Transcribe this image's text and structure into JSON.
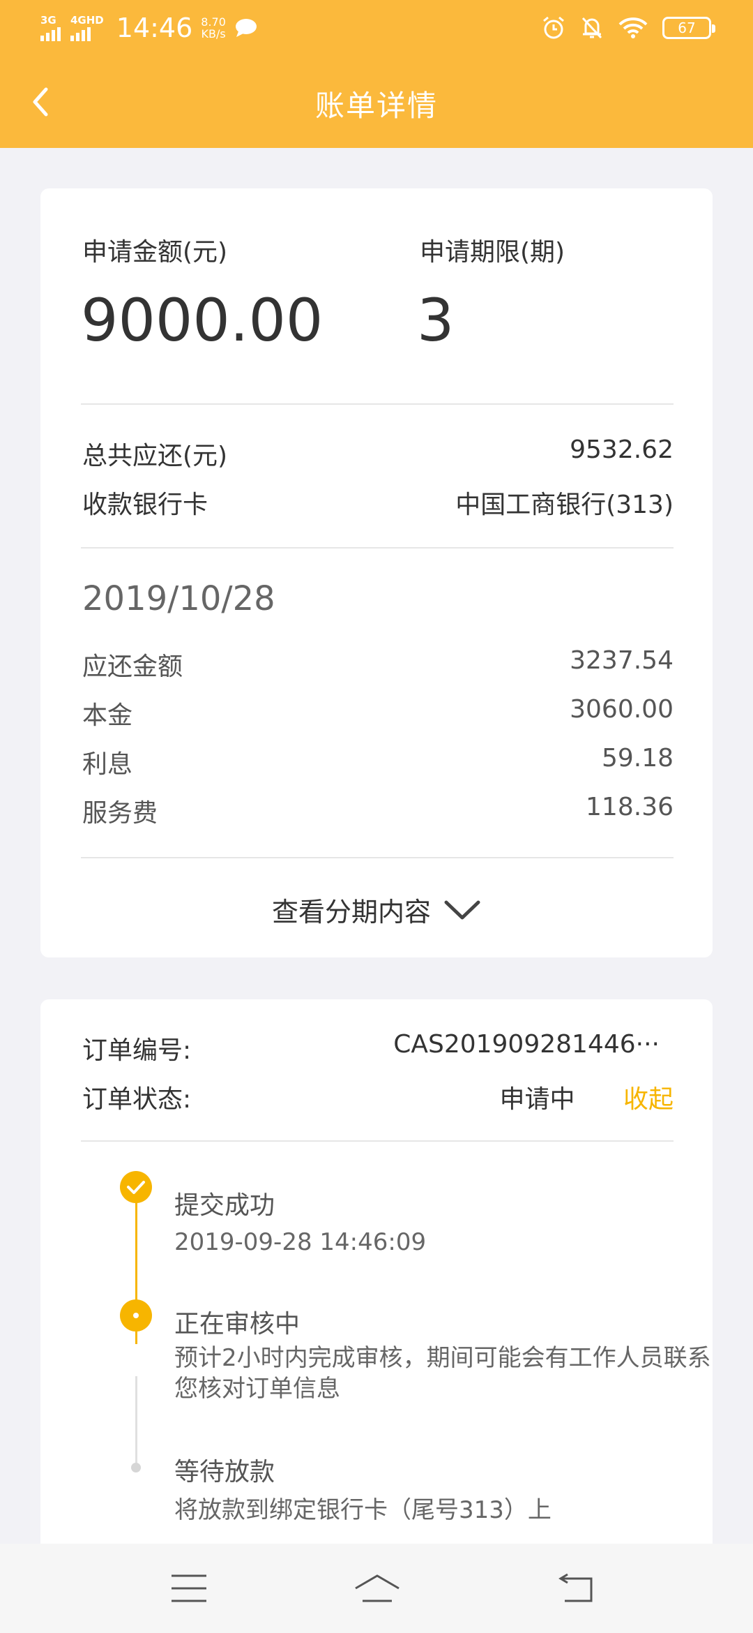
{
  "status_bar": {
    "signal1": "3G",
    "signal2": "4GHD",
    "time": "14:46",
    "speed_value": "8.70",
    "speed_unit": "KB/s",
    "battery": "67",
    "icons": [
      "chat-bubble-icon",
      "alarm-icon",
      "mute-bell-icon",
      "wifi-icon",
      "battery-icon"
    ]
  },
  "header": {
    "title": "账单详情",
    "back_icon": "chevron-left-icon",
    "color": "#fbb93c"
  },
  "summary": {
    "amount_label": "申请金额(元)",
    "amount_value": "9000.00",
    "term_label": "申请期限(期)",
    "term_value": "3",
    "total_label": "总共应还(元)",
    "total_value": "9532.62",
    "card_label": "收款银行卡",
    "card_value": "中国工商银行(313)"
  },
  "installment": {
    "date": "2019/10/28",
    "rows": [
      {
        "label": "应还金额",
        "value": "3237.54"
      },
      {
        "label": "本金",
        "value": "3060.00"
      },
      {
        "label": "利息",
        "value": "59.18"
      },
      {
        "label": "服务费",
        "value": "118.36"
      }
    ],
    "expand_label": "查看分期内容",
    "expand_icon": "chevron-down-icon"
  },
  "order": {
    "number_label": "订单编号:",
    "number_value": "CAS201909281446···",
    "status_label": "订单状态:",
    "status_value": "申请中",
    "collapse_label": "收起",
    "accent_color": "#f7b500"
  },
  "timeline": [
    {
      "title": "提交成功",
      "sub": "2019-09-28 14:46:09",
      "state": "done"
    },
    {
      "title": "正在审核中",
      "sub": "预计2小时内完成审核，期间可能会有工作人员联系您核对订单信息",
      "state": "active"
    },
    {
      "title": "等待放款",
      "sub": "将放款到绑定银行卡（尾号313）上",
      "state": "pending"
    }
  ],
  "nav_bar": {
    "icons": [
      "menu-icon",
      "home-icon",
      "back-arrow-icon"
    ]
  }
}
